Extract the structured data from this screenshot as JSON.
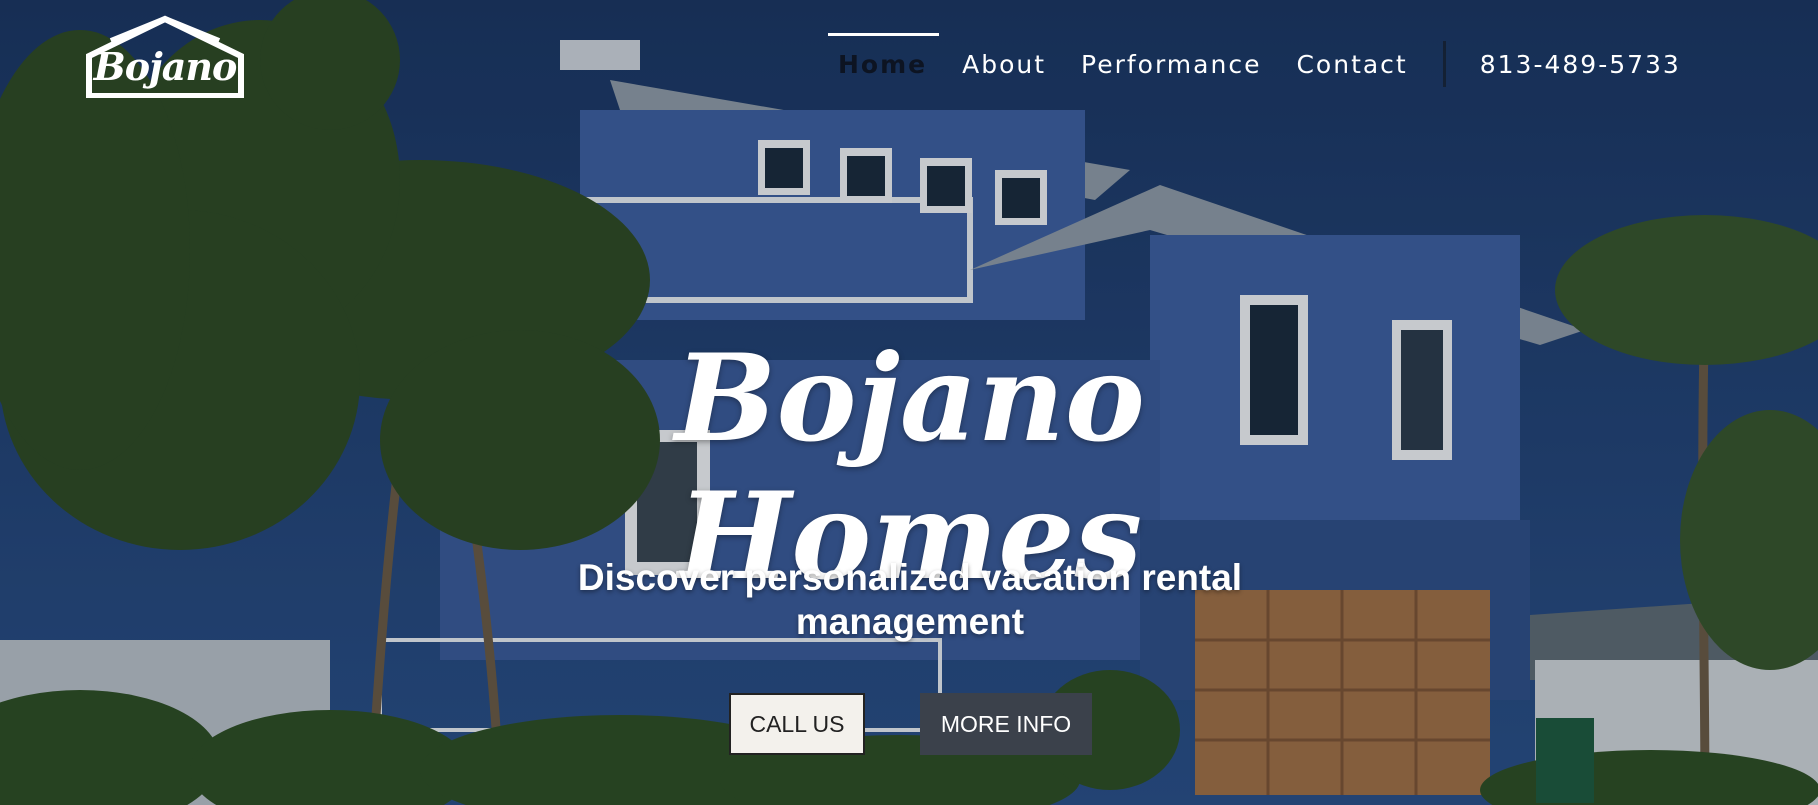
{
  "logo": {
    "text": "Bojano",
    "icon": "house-outline-icon"
  },
  "nav": {
    "items": [
      {
        "label": "Home",
        "active": true
      },
      {
        "label": "About",
        "active": false
      },
      {
        "label": "Performance",
        "active": false
      },
      {
        "label": "Contact",
        "active": false
      }
    ],
    "phone": "813-489-5733"
  },
  "hero": {
    "title_line1": "Bojano",
    "title_line2": "Homes",
    "tagline_line1": "Discover personalized vacation rental",
    "tagline_line2": "management",
    "background": "blue-two-story-beach-house-with-palm-trees-photo"
  },
  "buttons": {
    "call_label": "CALL US",
    "info_label": "MORE INFO"
  },
  "colors": {
    "sky": "#1f3a66",
    "house_siding": "#3d5f9e",
    "palm_green": "#2f4a22",
    "button_dark": "#3b414b",
    "button_light": "#f3f1ec"
  }
}
